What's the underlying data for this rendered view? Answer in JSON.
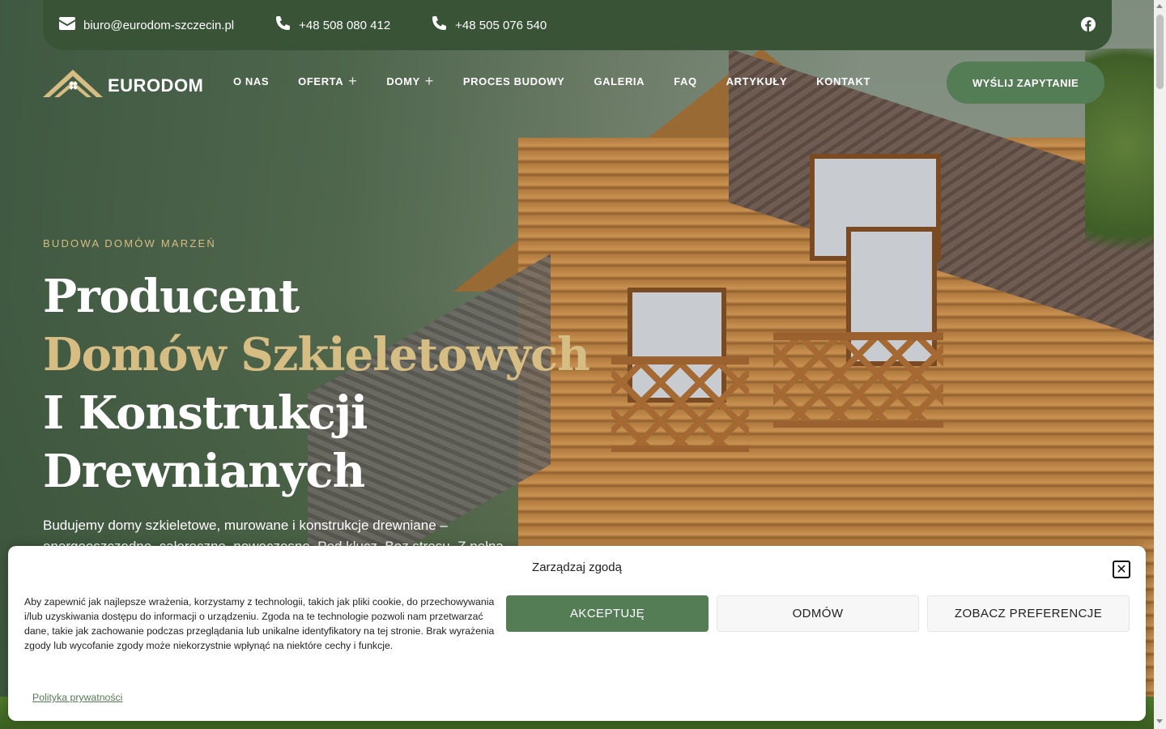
{
  "topbar": {
    "email": "biuro@eurodom-szczecin.pl",
    "phone1": "+48 508 080 412",
    "phone2": "+48 505 076 540",
    "social_icon": "facebook-icon"
  },
  "logo": {
    "text": "EURODOM"
  },
  "nav": {
    "items": [
      {
        "label": "O NAS"
      },
      {
        "label": "OFERTA",
        "expand": "+"
      },
      {
        "label": "DOMY",
        "expand": "+"
      },
      {
        "label": "PROCES BUDOWY"
      },
      {
        "label": "GALERIA"
      },
      {
        "label": "FAQ"
      },
      {
        "label": "ARTYKUŁY"
      },
      {
        "label": "KONTAKT"
      }
    ],
    "cta": "WYŚLIJ ZAPYTANIE"
  },
  "hero": {
    "eyebrow": "BUDOWA DOMÓW MARZEŃ",
    "title_line1": "Producent",
    "title_gold": "Domów Szkieletowych",
    "title_rest": " I Konstrukcji Drewnianych",
    "lead": "Budujemy domy szkieletowe, murowane i konstrukcje drewniane – energooszczędne, całoroczne, nowoczesne. Pod klucz. Bez stresu. Z pełną"
  },
  "cookie": {
    "title": "Zarządzaj zgodą",
    "text": "Aby zapewnić jak najlepsze wrażenia, korzystamy z technologii, takich jak pliki cookie, do przechowywania i/lub uzyskiwania dostępu do informacji o urządzeniu. Zgoda na te technologie pozwoli nam przetwarzać dane, takie jak zachowanie podczas przeglądania lub unikalne identyfikatory na tej stronie. Brak wyrażenia zgody lub wycofanie zgody może niekorzystnie wpłynąć na niektóre cechy i funkcje.",
    "accept": "AKCEPTUJĘ",
    "deny": "ODMÓW",
    "prefs": "ZOBACZ PREFERENCJE",
    "policy_link": "Polityka prywatności",
    "close_icon": "close-icon"
  },
  "colors": {
    "brand_green": "#547c55",
    "dark_green": "#385336",
    "gold": "#d6bd83"
  }
}
